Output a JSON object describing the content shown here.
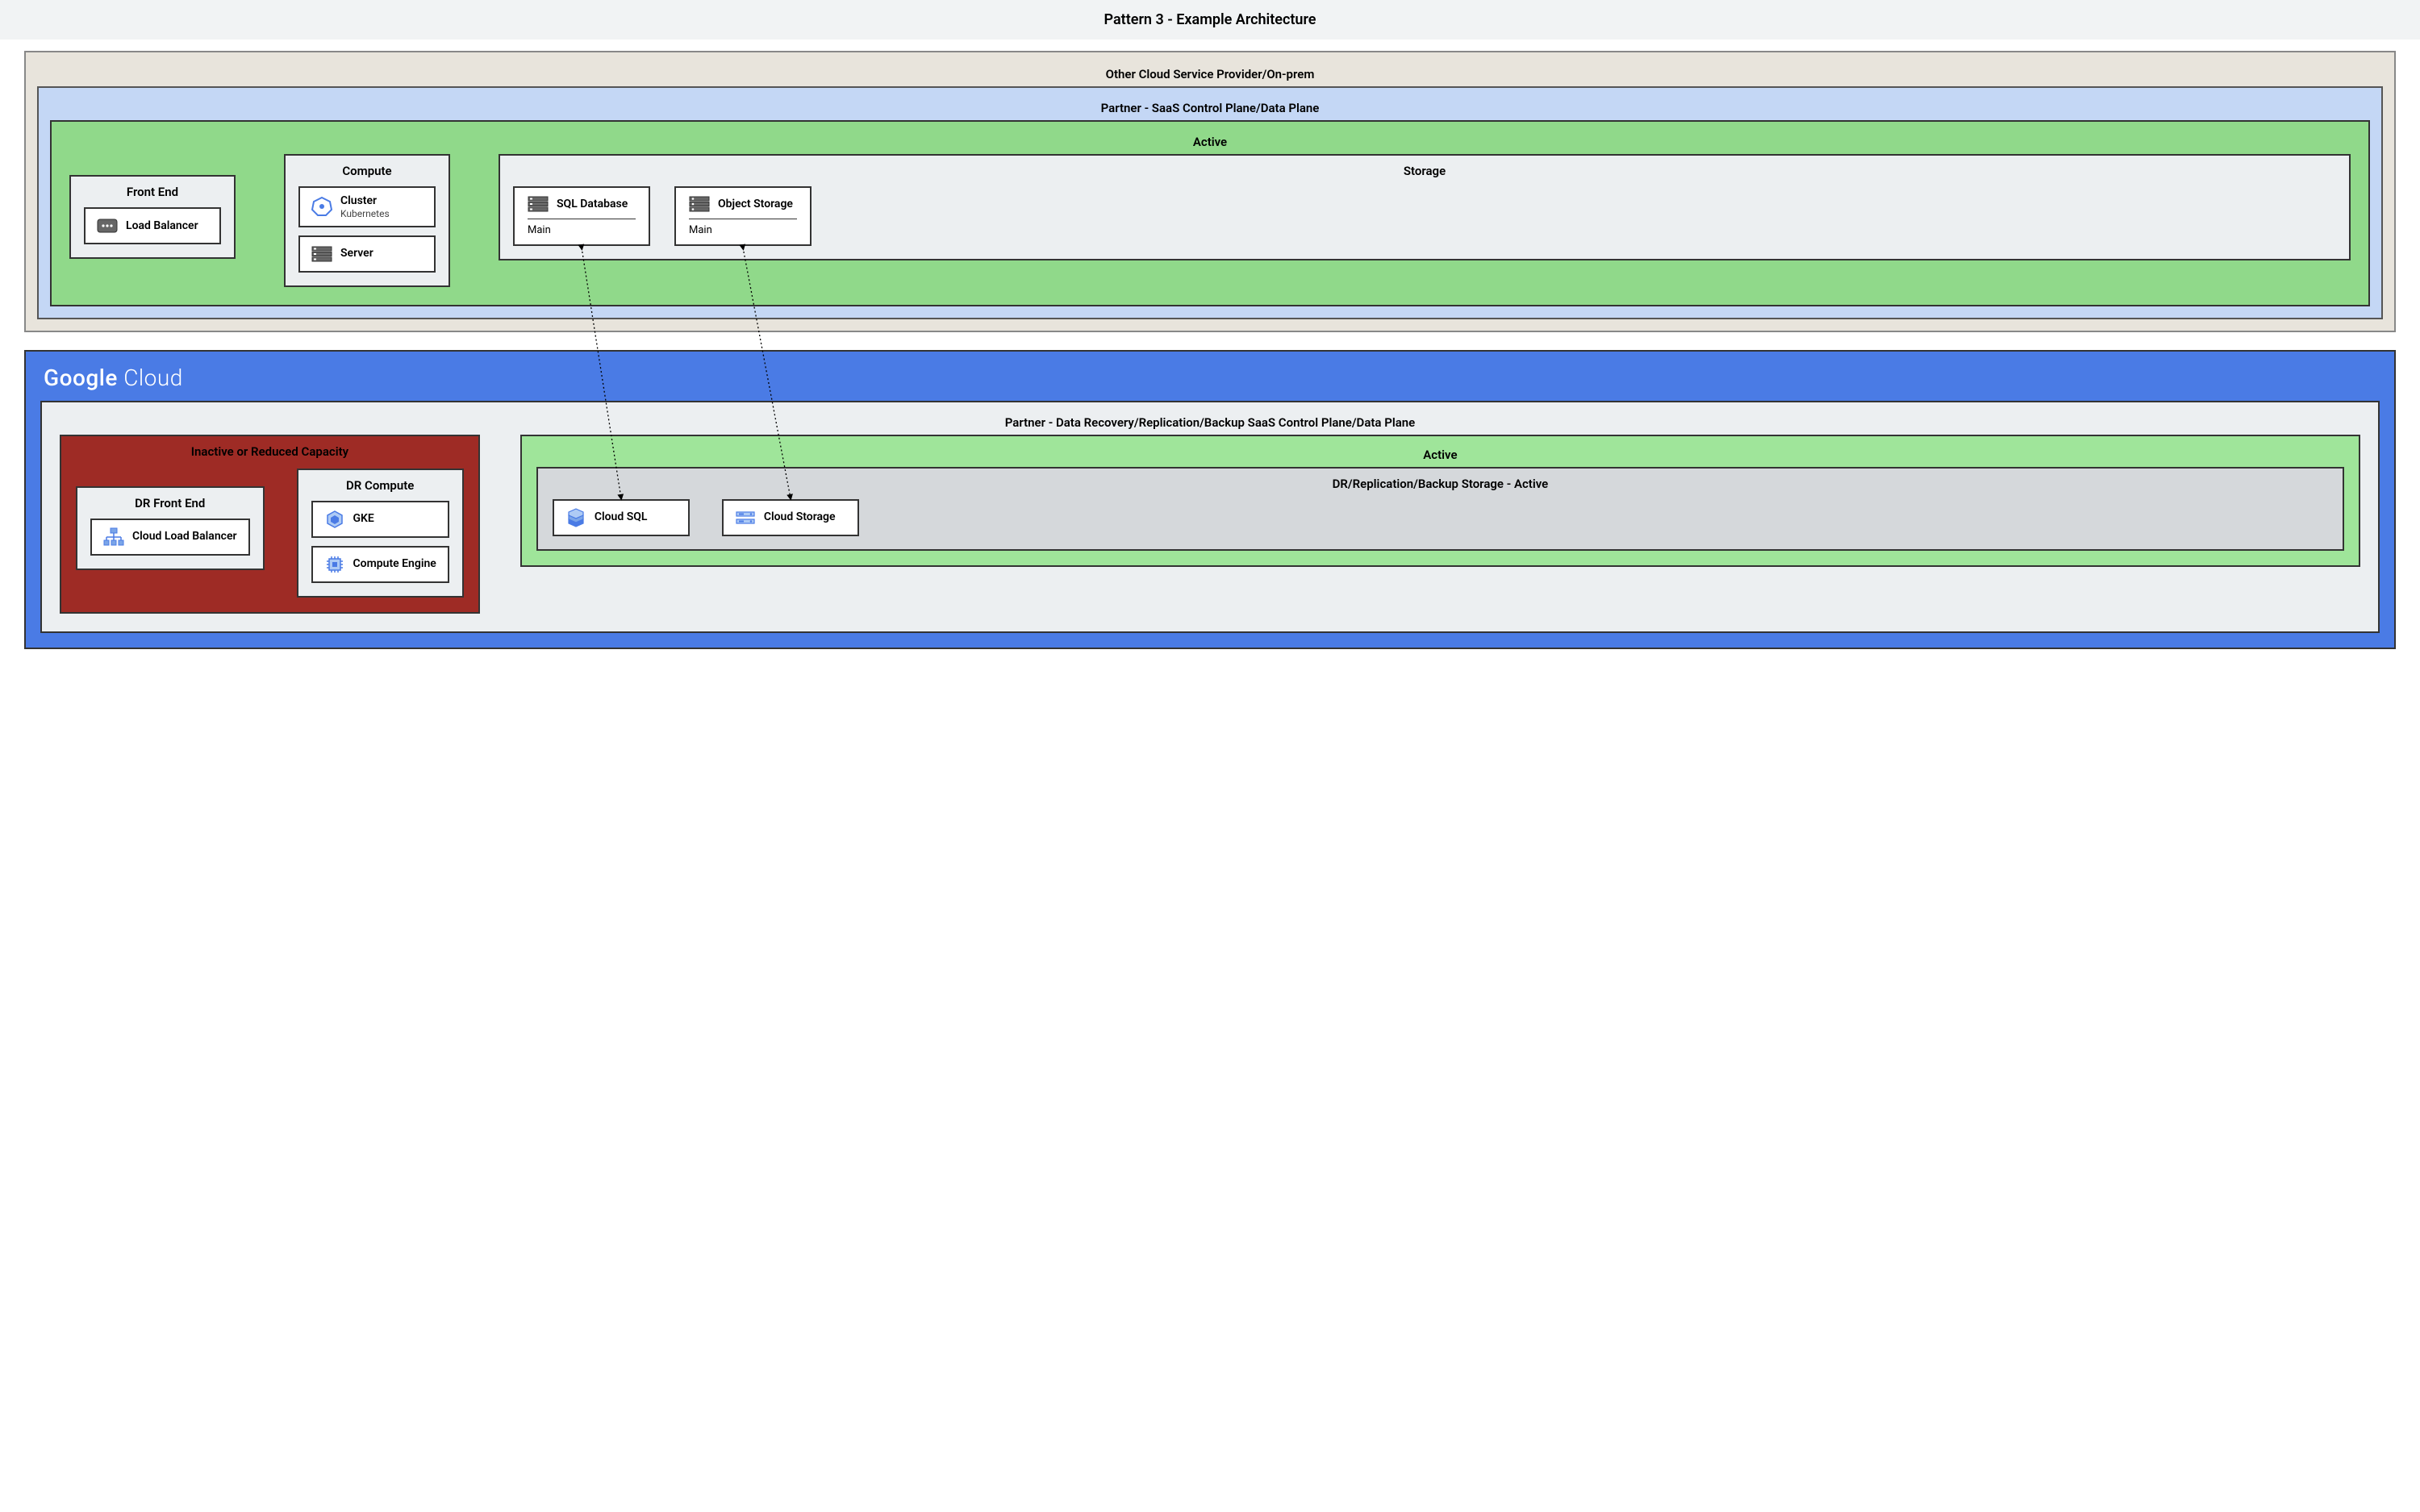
{
  "title": "Pattern 3 - Example Architecture",
  "csp": {
    "label": "Other Cloud Service Provider/On-prem",
    "partner": {
      "label": "Partner - SaaS Control Plane/Data Plane",
      "active": {
        "label": "Active",
        "frontend": {
          "label": "Front End",
          "lb": "Load Balancer"
        },
        "compute": {
          "label": "Compute",
          "k8s": {
            "title": "Cluster",
            "sub": "Kubernetes"
          },
          "server": "Server"
        },
        "storage": {
          "label": "Storage",
          "sql": {
            "title": "SQL Database",
            "sub": "Main"
          },
          "obj": {
            "title": "Object Storage",
            "sub": "Main"
          }
        }
      }
    }
  },
  "gcloud": {
    "brand_a": "Google",
    "brand_b": "Cloud",
    "partner": {
      "label": "Partner - Data Recovery/Replication/Backup SaaS Control Plane/Data Plane",
      "inactive": {
        "label": "Inactive or Reduced Capacity",
        "frontend": {
          "label": "DR Front End",
          "clb": "Cloud Load Balancer"
        },
        "compute": {
          "label": "DR Compute",
          "gke": "GKE",
          "gce": "Compute Engine"
        }
      },
      "active": {
        "label": "Active",
        "storage": {
          "label": "DR/Replication/Backup Storage - Active",
          "csql": "Cloud SQL",
          "cs": "Cloud Storage"
        }
      }
    }
  }
}
